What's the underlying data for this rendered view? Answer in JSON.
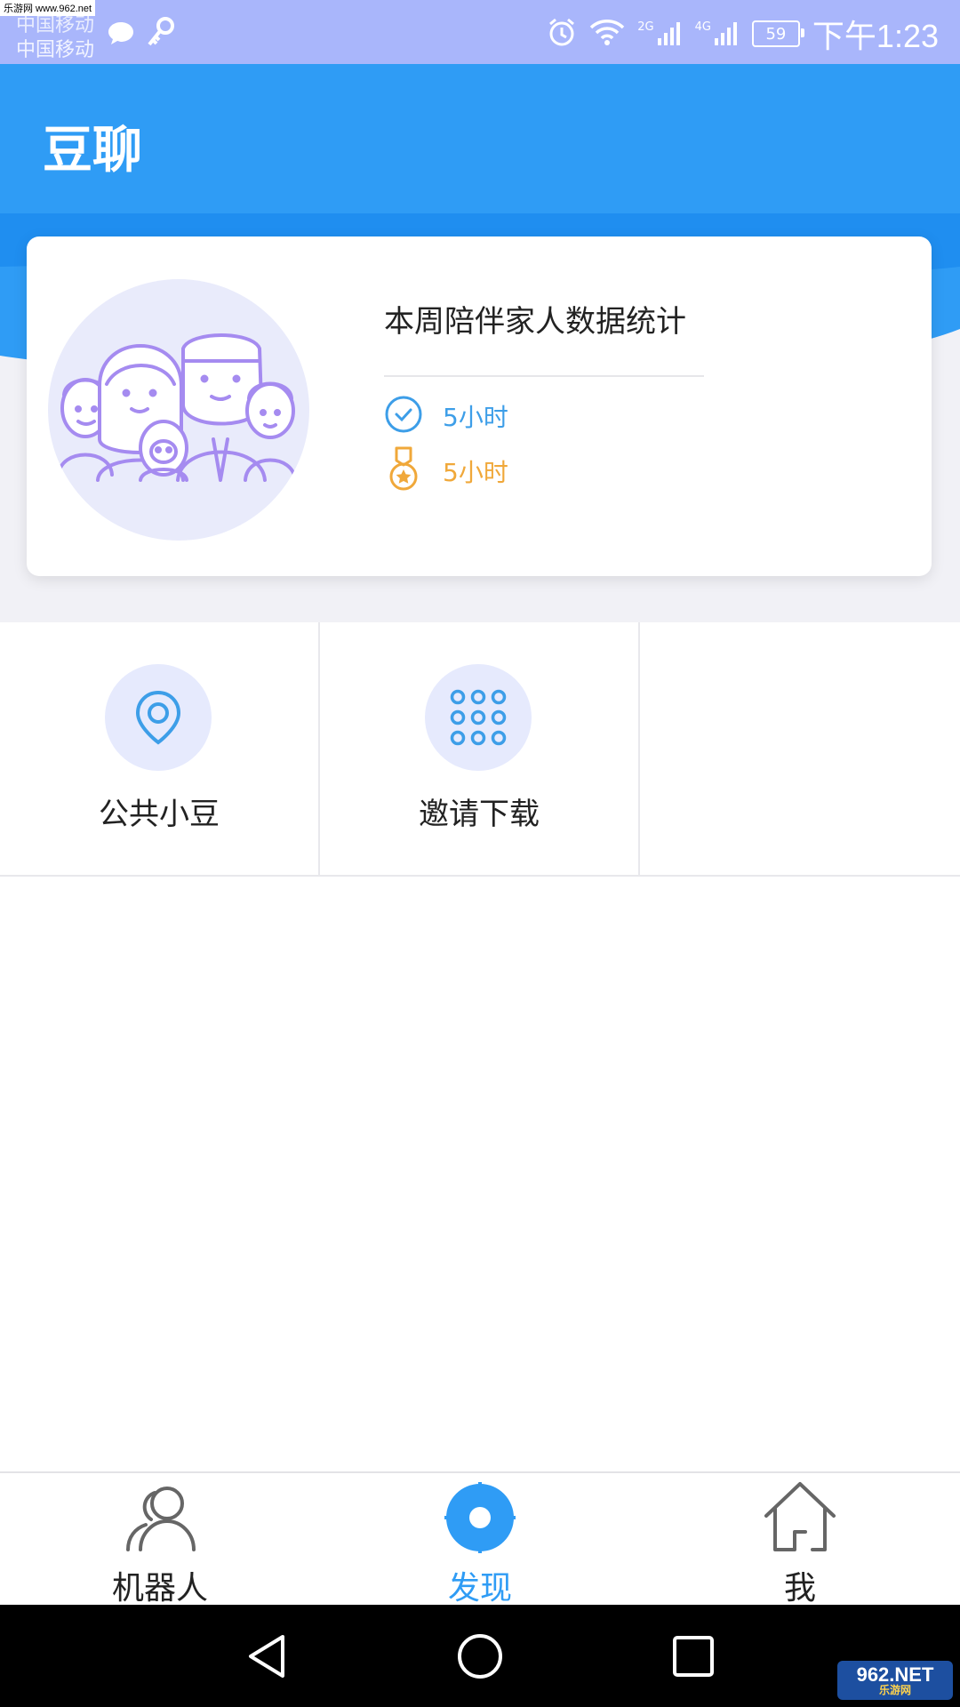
{
  "watermark": {
    "top_text": "乐游网 www.962.net",
    "bottom_big": "962.NET",
    "bottom_small": "乐游网"
  },
  "status_bar": {
    "carrier_1": "中国移动",
    "carrier_2": "中国移动",
    "network_1": "2G",
    "network_2": "4G",
    "battery": "59",
    "time": "下午1:23"
  },
  "header": {
    "title": "豆聊"
  },
  "stats_card": {
    "title": "本周陪伴家人数据统计",
    "rows": [
      {
        "icon": "clock-check-icon",
        "value": "5小时",
        "color": "#3d9ee8"
      },
      {
        "icon": "medal-icon",
        "value": "5小时",
        "color": "#f0a83a"
      }
    ]
  },
  "grid": {
    "items": [
      {
        "icon": "location-pin-icon",
        "label": "公共小豆"
      },
      {
        "icon": "grid-dots-icon",
        "label": "邀请下载"
      }
    ]
  },
  "tabbar": {
    "active_color": "#2f9cf5",
    "inactive_color": "#222222",
    "items": [
      {
        "icon": "users-icon",
        "label": "机器人",
        "active": false
      },
      {
        "icon": "discover-icon",
        "label": "发现",
        "active": true
      },
      {
        "icon": "home-icon",
        "label": "我",
        "active": false
      }
    ]
  }
}
